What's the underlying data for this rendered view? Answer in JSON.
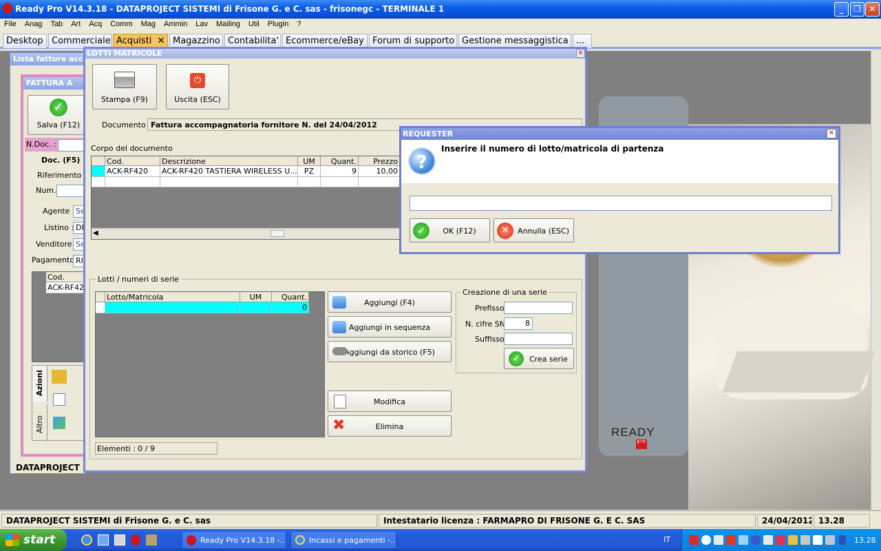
{
  "window": {
    "title": "Ready Pro V14.3.18 - DATAPROJECT SISTEMI di Frisone G. e C. sas - frisonegc - TERMINALE 1"
  },
  "menu": [
    "File",
    "Anag",
    "Tab",
    "Art",
    "Acq",
    "Comm",
    "Mag",
    "Ammin",
    "Lav",
    "Mailing",
    "Util",
    "Plugin",
    "?"
  ],
  "tabs": {
    "desktop": "Desktop",
    "commerciale": "Commerciale",
    "acquisti": "Acquisti",
    "magazzino": "Magazzino",
    "contabilita": "Contabilita'",
    "ecommerce": "Ecommerce/eBay",
    "forum": "Forum di supporto",
    "messaggistica": "Gestione messaggistica",
    "more": "..."
  },
  "bg": {
    "lista_title": "Lista fatture accon",
    "fattura_title": "FATTURA A",
    "salva": "Salva (F12)",
    "ndoc": "N.Doc. :",
    "doc_tab": "Doc. (F5)",
    "riferimento": "Riferimento do",
    "num": "Num.:",
    "agente": "Agente :",
    "agente_val": "Se",
    "listino": "Listino :",
    "listino_val": "DE",
    "venditore": "Venditore :",
    "venditore_val": "Se",
    "pagamento": "Pagamento :",
    "pagamento_val": "RI",
    "cod": "Cod.",
    "cod_val": "ACK-RF42",
    "azioni": "Azioni",
    "altro": "Altro",
    "footer": "DATAPROJECT S"
  },
  "lotti": {
    "title": "LOTTI MATRICOLE",
    "stampa": "Stampa (F9)",
    "uscita": "Uscita (ESC)",
    "documento_label": "Documento :",
    "documento_value": "Fattura accompagnatoria fornitore N.  del 24/04/2012",
    "corpo_label": "Corpo del documento",
    "corpo_headers": {
      "cod": "Cod.",
      "descrizione": "Descrizione",
      "um": "UM",
      "quant": "Quant.",
      "prezzo": "Prezzo"
    },
    "corpo_row": {
      "cod": "ACK-RF420",
      "descrizione": "ACK-RF420 TASTIERA WIRELESS U...",
      "um": "PZ",
      "quant": "9",
      "prezzo": "10,00"
    },
    "lotti_label": "Lotti / numeri di serie",
    "lotti_headers": {
      "lotto": "Lotto/Matricola",
      "um": "UM",
      "quant": "Quant."
    },
    "lotti_row": {
      "quant": "0"
    },
    "aggiungi": "Aggiungi (F4)",
    "aggiungi_seq": "Aggiungi in sequenza",
    "aggiungi_storico": "Aggiungi da storico (F5)",
    "modifica": "Modifica",
    "elimina": "Elimina",
    "serie_label": "Creazione di una serie",
    "prefisso": "Prefisso",
    "ncifre": "N. cifre SN",
    "ncifre_val": "8",
    "suffisso": "Suffisso",
    "crea_serie": "Crea serie",
    "elementi": "Elementi : 0 / 9"
  },
  "requester": {
    "title": "REQUESTER",
    "message": "Inserire il numero di lotto/matricola di partenza",
    "input_value": "",
    "ok": "OK (F12)",
    "annulla": "Annulla (ESC)"
  },
  "logo": {
    "text": "READY",
    "sub": "pro"
  },
  "status": {
    "company": "DATAPROJECT SISTEMI di Frisone G. e C. sas",
    "license": "Intestatario licenza : FARMAPRO DI FRISONE G. E C. SAS",
    "date": "24/04/2012",
    "time": "13.28"
  },
  "taskbar": {
    "start": "start",
    "item1": "Ready Pro V14.3.18 -...",
    "item2": "Incassi e pagamenti -...",
    "lang": "IT",
    "clock": "13.28"
  },
  "colors": {
    "titlebar": "#0a5ee6",
    "active_tab": "#f6c45c",
    "highlight_row": "#00ffff",
    "dialog_border": "#6f7ec9"
  }
}
